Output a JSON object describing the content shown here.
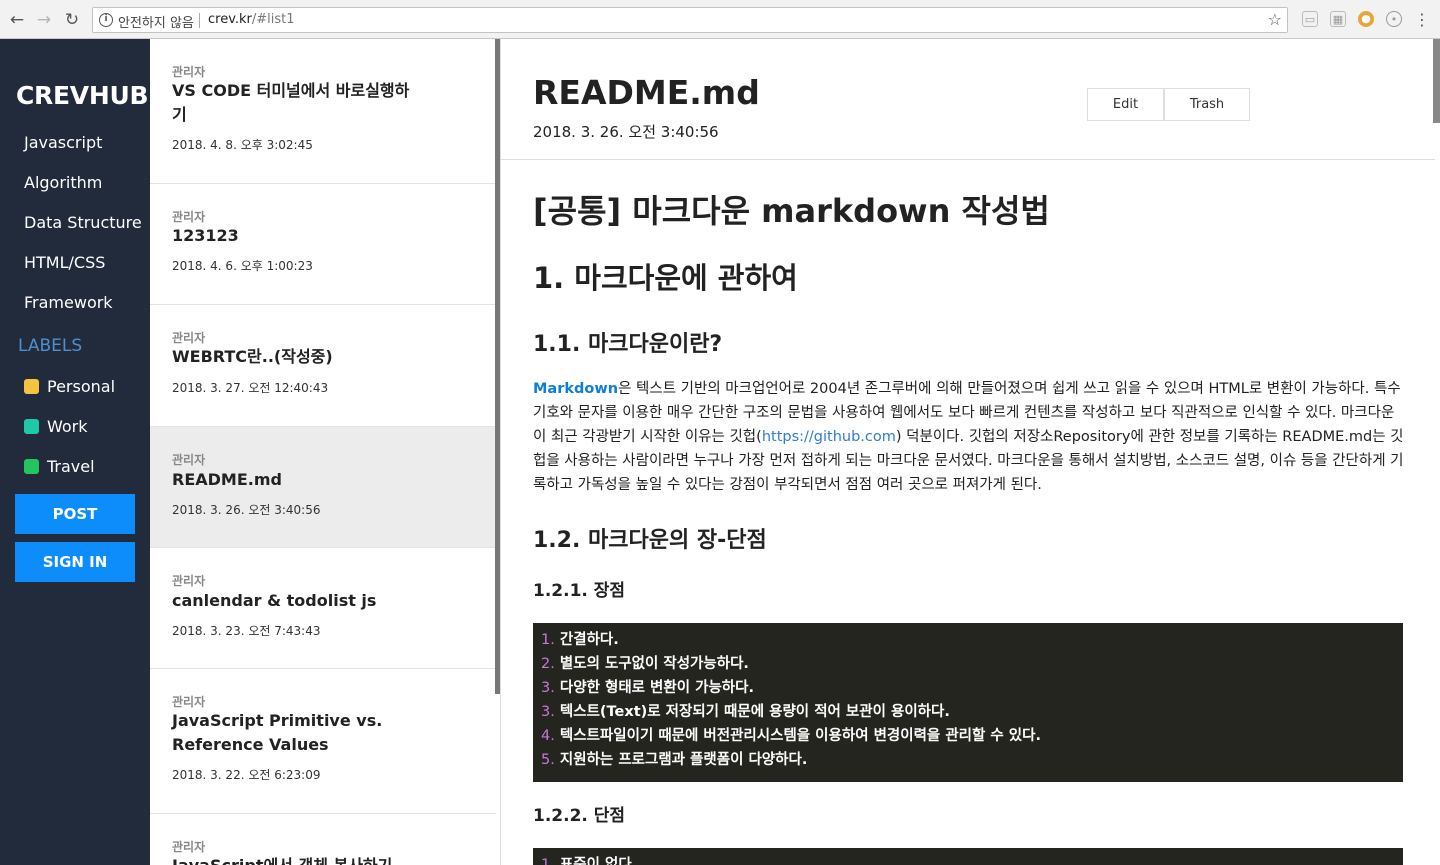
{
  "browser": {
    "security_label": "안전하지 않음",
    "url_host": "crev.kr",
    "url_hash": "/#list1"
  },
  "sidebar": {
    "logo": "CREVHUB",
    "categories": [
      "Javascript",
      "Algorithm",
      "Data Structure",
      "HTML/CSS",
      "Framework"
    ],
    "labels_title": "LABELS",
    "labels": [
      {
        "name": "Personal",
        "color": "#f5c342"
      },
      {
        "name": "Work",
        "color": "#1dc9a8"
      },
      {
        "name": "Travel",
        "color": "#22c55e"
      }
    ],
    "post_button": "POST",
    "signin_button": "SIGN IN"
  },
  "posts": [
    {
      "author": "관리자",
      "title": "VS CODE 터미널에서 바로실행하기",
      "date": "2018. 4. 8. 오후 3:02:45"
    },
    {
      "author": "관리자",
      "title": "123123",
      "date": "2018. 4. 6. 오후 1:00:23"
    },
    {
      "author": "관리자",
      "title": "WEBRTC란..(작성중)",
      "date": "2018. 3. 27. 오전 12:40:43"
    },
    {
      "author": "관리자",
      "title": "README.md",
      "date": "2018. 3. 26. 오전 3:40:56",
      "selected": true
    },
    {
      "author": "관리자",
      "title": "canlendar & todolist js",
      "date": "2018. 3. 23. 오전 7:43:43"
    },
    {
      "author": "관리자",
      "title": "JavaScript Primitive vs. Reference Values",
      "date": "2018. 3. 22. 오전 6:23:09"
    },
    {
      "author": "관리자",
      "title": "JavaScript에서 객체 복사하기",
      "date": ""
    }
  ],
  "article": {
    "title": "README.md",
    "date": "2018. 3. 26. 오전 3:40:56",
    "edit_label": "Edit",
    "trash_label": "Trash",
    "h1": "[공통] 마크다운 markdown 작성법",
    "h2": "1. 마크다운에 관하여",
    "h3_intro": "1.1. 마크다운이란?",
    "para_term": "Markdown",
    "para_part1": "은 텍스트 기반의 마크업언어로 2004년 존그루버에 의해 만들어졌으며 쉽게 쓰고 읽을 수 있으며 HTML로 변환이 가능하다. 특수기호와 문자를 이용한 매우 간단한 구조의 문법을 사용하여 웹에서도 보다 빠르게 컨텐츠를 작성하고 보다 직관적으로 인식할 수 있다. 마크다운이 최근 각광받기 시작한 이유는 깃헙(",
    "para_link": "https://github.com",
    "para_part2": ") 덕분이다. 깃헙의 저장소Repository에 관한 정보를 기록하는 README.md는 깃헙을 사용하는 사람이라면 누구나 가장 먼저 접하게 되는 마크다운 문서였다. 마크다운을 통해서 설치방법, 소스코드 설명, 이슈 등을 간단하게 기록하고 가독성을 높일 수 있다는 강점이 부각되면서 점점 여러 곳으로 퍼져가게 된다.",
    "h3_pros_cons": "1.2. 마크다운의 장-단점",
    "h4_pros": "1.2.1. 장점",
    "pros": [
      {
        "num": "1.",
        "text": "간결하다."
      },
      {
        "num": "2.",
        "text": "별도의 도구없이 작성가능하다."
      },
      {
        "num": "3.",
        "text": "다양한 형태로 변환이 가능하다."
      },
      {
        "num": "3.",
        "text": "텍스트(Text)로 저장되기 때문에 용량이 적어 보관이 용이하다."
      },
      {
        "num": "4.",
        "text": "텍스트파일이기 때문에 버전관리시스템을 이용하여 변경이력을 관리할 수 있다."
      },
      {
        "num": "5.",
        "text": "지원하는 프로그램과 플랫폼이 다양하다."
      }
    ],
    "h4_cons": "1.2.2. 단점",
    "cons": [
      {
        "num": "1.",
        "text": "표준이 없다."
      }
    ]
  }
}
